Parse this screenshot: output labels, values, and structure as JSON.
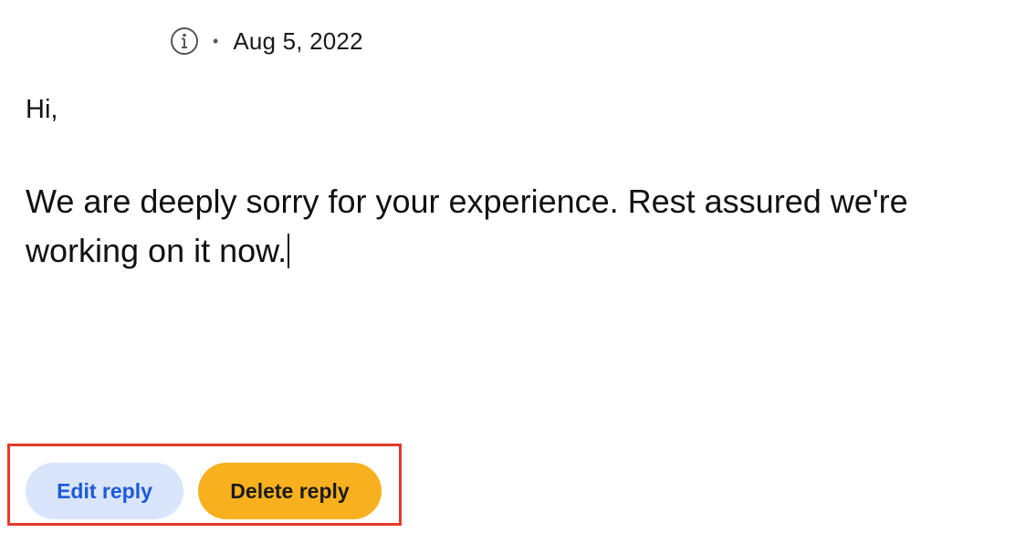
{
  "meta": {
    "info_icon": "info-circle-icon",
    "separator": "•",
    "date": "Aug 5, 2022"
  },
  "message": {
    "greeting": "Hi,",
    "body": "We are deeply sorry for your experience. Rest assured we're working on it now."
  },
  "actions": {
    "edit_label": "Edit reply",
    "delete_label": "Delete reply"
  },
  "colors": {
    "edit_bg": "#d9e5fb",
    "edit_text": "#1b5ad8",
    "delete_bg": "#f8b01f",
    "highlight_border": "#e43a2a"
  }
}
